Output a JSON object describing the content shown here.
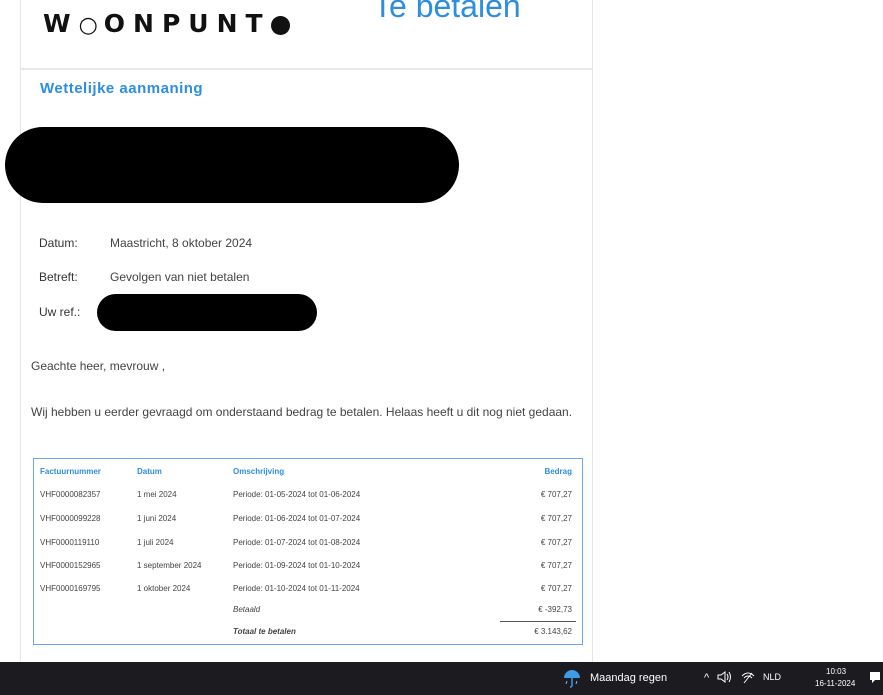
{
  "email": {
    "header": {
      "logo_text": "WOONPUNT",
      "link_text": "Te betalen"
    },
    "heading": "Wettelijke aanmaning",
    "meta": {
      "date_label": "Datum:",
      "date_value": "Maastricht, 8 oktober 2024",
      "subject_label": "Betreft:",
      "subject_value": "Gevolgen van niet betalen",
      "ref_label": "Uw ref.:"
    },
    "salutation": "Geachte heer, mevrouw ,",
    "body_text": "Wij hebben u eerder gevraagd om onderstaand bedrag te betalen. Helaas heeft u dit nog niet gedaan."
  },
  "invoice_table": {
    "columns": [
      "Factuurnummer",
      "Datum",
      "Omschrijving",
      "Bedrag"
    ],
    "rows": [
      {
        "number": "VHF0000082357",
        "date": "1 mei 2024",
        "description": "Periode: 01-05-2024 tot 01-06-2024",
        "amount": "€ 707,27"
      },
      {
        "number": "VHF0000099228",
        "date": "1 juni 2024",
        "description": "Periode: 01-06-2024 tot 01-07-2024",
        "amount": "€ 707,27"
      },
      {
        "number": "VHF0000119110",
        "date": "1 juli 2024",
        "description": "Periode: 01-07-2024 tot 01-08-2024",
        "amount": "€ 707,27"
      },
      {
        "number": "VHF0000152965",
        "date": "1 september 2024",
        "description": "Periode: 01-09-2024 tot 01-10-2024",
        "amount": "€ 707,27"
      },
      {
        "number": "VHF0000169795",
        "date": "1 oktober 2024",
        "description": "Periode: 01-10-2024 tot 01-11-2024",
        "amount": "€ 707,27"
      }
    ],
    "balance_label": "Betaald",
    "balance_amount": "€ -392,73",
    "total_label": "Totaal te betalen",
    "total_amount": "€ 3.143,62"
  },
  "taskbar": {
    "weather_text": "Maandag regen",
    "chevron": "^",
    "language": "NLD",
    "time": "10:03",
    "date": "16-11-2024",
    "icons": [
      "weather-rain-icon",
      "volume-icon",
      "network-icon",
      "notification-icon"
    ]
  }
}
